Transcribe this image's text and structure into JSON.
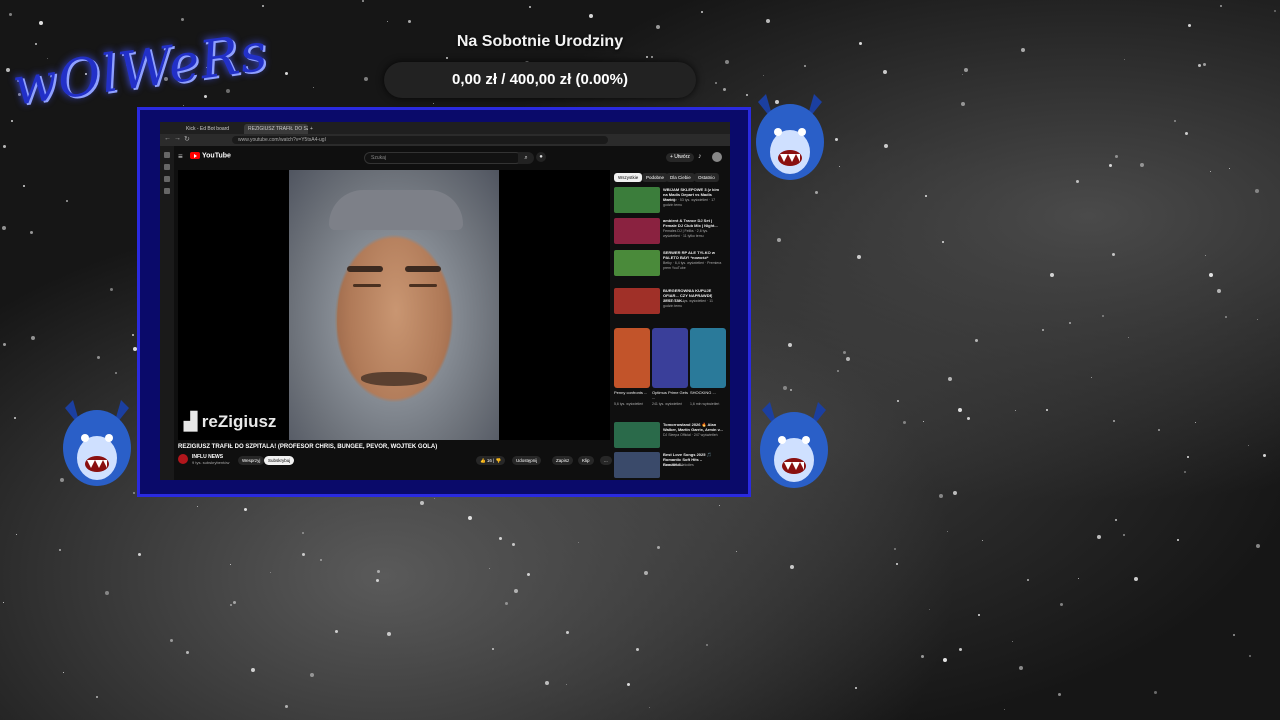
{
  "overlay": {
    "goal_title": "Na Sobotnie Urodziny",
    "goal_amount": "0,00 zł / 400,00 zł (0.00%)",
    "logo_text": "wOlWeRs",
    "goal_progress": 0
  },
  "browser": {
    "tabs": [
      {
        "label": "Kick - Ed Bot board"
      },
      {
        "label": "REZIGIUSZ TRAFIŁ DO SZP"
      }
    ],
    "url": "www.youtube.com/watch?v=Y5tsA4-ugI",
    "new_tab": "+"
  },
  "youtube": {
    "logo": "YouTube",
    "search_placeholder": "Szukaj",
    "create_label": "+ Utwórz",
    "video": {
      "watermark": "reZigiusz",
      "title": "REZIGIUSZ TRAFIŁ DO SZPITALA! (PROFESOR CHRIS, BUNGEE, PEVOR, WOJTEK GOLA)",
      "channel": "INFLU NEWS",
      "subscribers": "9 tys. subskrybentów",
      "join_label": "Wesprzyj",
      "subscribe_label": "Subskrybuj",
      "likes": "16",
      "share_label": "Udostępnij",
      "save_label": "Zapisz",
      "clip_label": "Klip",
      "more_label": "..."
    },
    "chips": [
      "Wszystkie",
      "Podobne",
      "Dla Ciebie",
      "Ostatnio"
    ],
    "recommendations": [
      {
        "title": "WBIJAM SKLEPOWE 3 (z kim na Madis Depart vs Madis Marin)",
        "meta": "Chrisdav · 53 tys. wyświetleń · 17 godzin temu",
        "color": "#3b7d3b"
      },
      {
        "title": "ambient & Trance DJ Set | Female DJ Club Mix | Night...",
        "meta": "Females DJ | Feliks · 2,6 tys. wyświetleń · 11 tylko temu",
        "color": "#8a2240"
      },
      {
        "title": "SERWER RP ALE TYLKO w PALETO BAY! *nowość*",
        "meta": "Betky · 6,4 tys. wyświetleń · Premiera prem YouTube",
        "color": "#4a8a3a"
      },
      {
        "title": "BURGEROWNIA KUPUJE OFIAR... CZY NAPRAWDĘ JEST TAK...",
        "meta": "FitFood · 84 tys. wyświetleń · 11 godzin temu",
        "color": "#a03028"
      }
    ],
    "shorts": [
      {
        "title": "Penny confronts ...",
        "meta": "5,6 tys. wyświetleń",
        "color": "#c2542a"
      },
      {
        "title": "Optimus Prime Gets ...",
        "meta": "241 tys. wyświetleń",
        "color": "#3a3f9a"
      },
      {
        "title": "SHOCKING ...",
        "meta": "1,6 mln wyświetleń",
        "color": "#2a7a9a"
      }
    ],
    "recommendations_bottom": [
      {
        "title": "Tomorrowland 2026 🔥 Alan Walker, Martin Garrix, Armin v...",
        "meta": "DJ Sleepa Official · 247 wyświetleń",
        "color": "#2a6a4a"
      },
      {
        "title": "Best Love Songs 2025 🎵 Romantic Soft Hits – Beautiful...",
        "meta": "Love Beat Melodies",
        "color": "#3a4a6a"
      }
    ]
  }
}
